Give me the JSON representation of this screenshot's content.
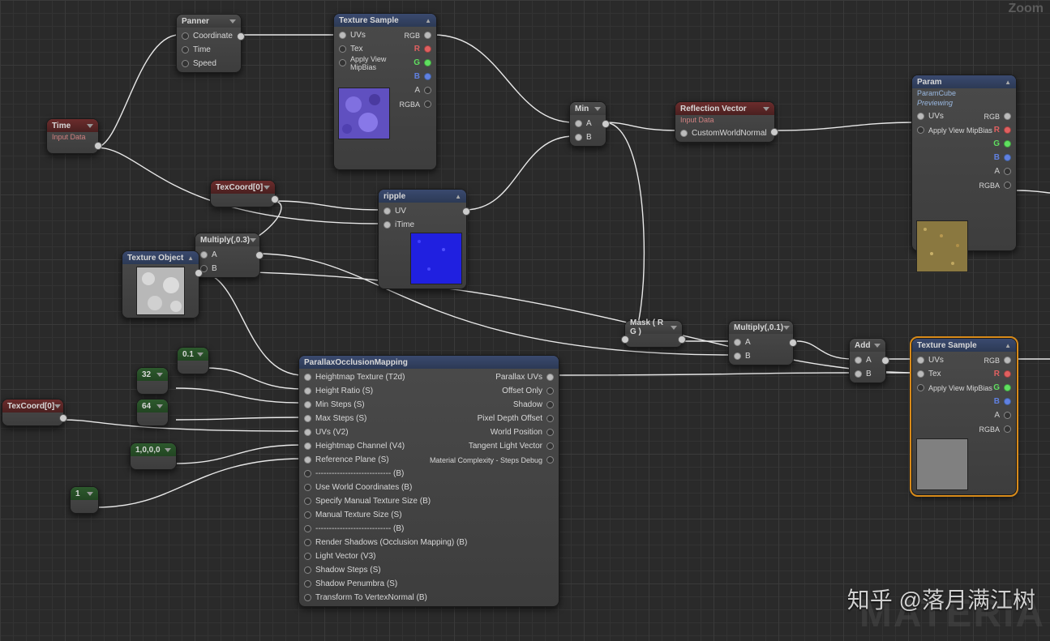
{
  "zoom_label": "Zoom",
  "big_watermark": "MATERIA",
  "credit": "知乎 @落月满江树",
  "nodes": {
    "time": {
      "title": "Time",
      "sub": "Input Data"
    },
    "panner": {
      "title": "Panner",
      "in1": "Coordinate",
      "in2": "Time",
      "in3": "Speed"
    },
    "texSample1": {
      "title": "Texture Sample",
      "in1": "UVs",
      "in2": "Tex",
      "in3": "Apply View MipBias",
      "oRGB": "RGB",
      "oR": "R",
      "oG": "G",
      "oB": "B",
      "oA": "A",
      "oRGBA": "RGBA"
    },
    "texcoord1": {
      "title": "TexCoord[0]"
    },
    "texObj": {
      "title": "Texture Object"
    },
    "mult03": {
      "title": "Multiply(,0.3)",
      "a": "A",
      "b": "B"
    },
    "ripple": {
      "title": "ripple",
      "in1": "UV",
      "in2": "iTime"
    },
    "min": {
      "title": "Min",
      "a": "A",
      "b": "B"
    },
    "refl": {
      "title": "Reflection Vector",
      "sub": "Input Data",
      "in1": "CustomWorldNormal"
    },
    "param": {
      "title": "Param",
      "sub1": "ParamCube",
      "sub2": "Previewing",
      "in1": "UVs",
      "in2": "Apply View MipBias",
      "oRGB": "RGB",
      "oR": "R",
      "oG": "G",
      "oB": "B",
      "oA": "A",
      "oRGBA": "RGBA"
    },
    "mask": {
      "title": "Mask ( R G )"
    },
    "mult01": {
      "title": "Multiply(,0.1)",
      "a": "A",
      "b": "B"
    },
    "add": {
      "title": "Add",
      "a": "A",
      "b": "B"
    },
    "texSample2": {
      "title": "Texture Sample",
      "in1": "UVs",
      "in2": "Tex",
      "in3": "Apply View MipBias",
      "oRGB": "RGB",
      "oR": "R",
      "oG": "G",
      "oB": "B",
      "oA": "A",
      "oRGBA": "RGBA"
    },
    "c01": {
      "v": "0.1"
    },
    "c32": {
      "v": "32"
    },
    "c64": {
      "v": "64"
    },
    "cV4": {
      "v": "1,0,0,0"
    },
    "c1": {
      "v": "1"
    },
    "texcoord2": {
      "title": "TexCoord[0]"
    },
    "pom": {
      "title": "ParallaxOcclusionMapping",
      "i1": "Heightmap Texture (T2d)",
      "i2": "Height Ratio (S)",
      "i3": "Min Steps (S)",
      "i4": "Max Steps (S)",
      "i5": "UVs (V2)",
      "i6": "Heightmap Channel (V4)",
      "i7": "Reference Plane (S)",
      "i8": "---------------------------- (B)",
      "i9": "Use World Coordinates (B)",
      "i10": "Specify Manual Texture Size (B)",
      "i11": "Manual Texture Size (S)",
      "i12": "---------------------------- (B)",
      "i13": "Render Shadows (Occlusion Mapping) (B)",
      "i14": "Light Vector (V3)",
      "i15": "Shadow Steps (S)",
      "i16": "Shadow Penumbra (S)",
      "i17": "Transform To VertexNormal (B)",
      "o1": "Parallax UVs",
      "o2": "Offset Only",
      "o3": "Shadow",
      "o4": "Pixel Depth Offset",
      "o5": "World Position",
      "o6": "Tangent Light Vector",
      "o7": "Material Complexity - Steps Debug"
    }
  }
}
